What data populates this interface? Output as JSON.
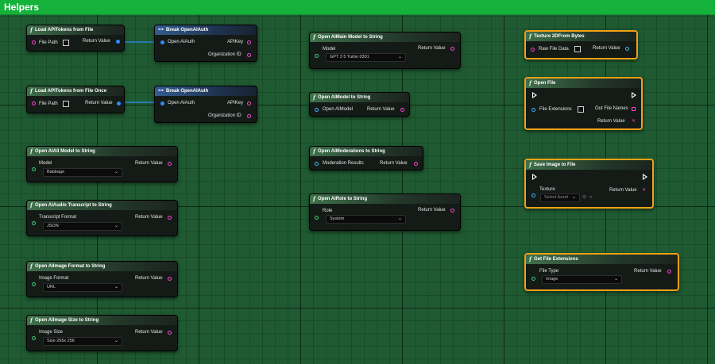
{
  "title": "Helpers",
  "colors": {
    "title_bar": "#15b23b",
    "grid": "#1f5a32",
    "string_pin": "#ff3fd0",
    "object_pin": "#3fb5ff",
    "selection": "#f2a117"
  },
  "nodes": {
    "load_tokens": {
      "title": "Load APITokens from File",
      "file_path": "File Path",
      "return_value": "Return Value"
    },
    "break1": {
      "title": "Break OpenAIAuth",
      "open_ai_auth": "Open AIAuth",
      "api_key": "APIKey",
      "org_id": "Organization ID"
    },
    "load_tokens_once": {
      "title": "Load APITokens from File Once",
      "file_path": "File Path",
      "return_value": "Return Value"
    },
    "break2": {
      "title": "Break OpenAIAuth",
      "open_ai_auth": "Open AIAuth",
      "api_key": "APIKey",
      "org_id": "Organization ID"
    },
    "all_model": {
      "title": "Open AIAll Model to String",
      "param": "Model",
      "value": "Babbage",
      "return_value": "Return Value"
    },
    "audio_transcript": {
      "title": "Open AIAudio Transcript to String",
      "param": "Transcript Format",
      "value": "JSON",
      "return_value": "Return Value"
    },
    "image_format": {
      "title": "Open AIImage Format to String",
      "param": "Image Format",
      "value": "URL",
      "return_value": "Return Value"
    },
    "image_size": {
      "title": "Open AIImage Size to String",
      "param": "Image Size",
      "value": "Size 256x 256",
      "return_value": "Return Value"
    },
    "main_model": {
      "title": "Open AIMain Model to String",
      "param": "Model",
      "value": "GPT 3 5 Turbo 0301",
      "return_value": "Return Value"
    },
    "model": {
      "title": "Open AIModel to String",
      "param": "Open AIModel",
      "return_value": "Return Value"
    },
    "moderations": {
      "title": "Open AIModerations to String",
      "param": "Moderation Results",
      "return_value": "Return Value"
    },
    "role": {
      "title": "Open AIRole to String",
      "param": "Role",
      "value": "System",
      "return_value": "Return Value"
    },
    "texture_bytes": {
      "title": "Texture 2DFrom Bytes",
      "param": "Raw File Data",
      "return_value": "Return Value"
    },
    "open_file": {
      "title": "Open File",
      "param": "File Extensions",
      "out_names": "Out File Names",
      "return_value": "Return Value"
    },
    "save_image": {
      "title": "Save Image to File",
      "param": "Texture",
      "value": "Select Asset",
      "return_value": "Return Value"
    },
    "get_ext": {
      "title": "Get File Extensions",
      "param": "File Type",
      "value": "Image",
      "return_value": "Return Value"
    }
  }
}
